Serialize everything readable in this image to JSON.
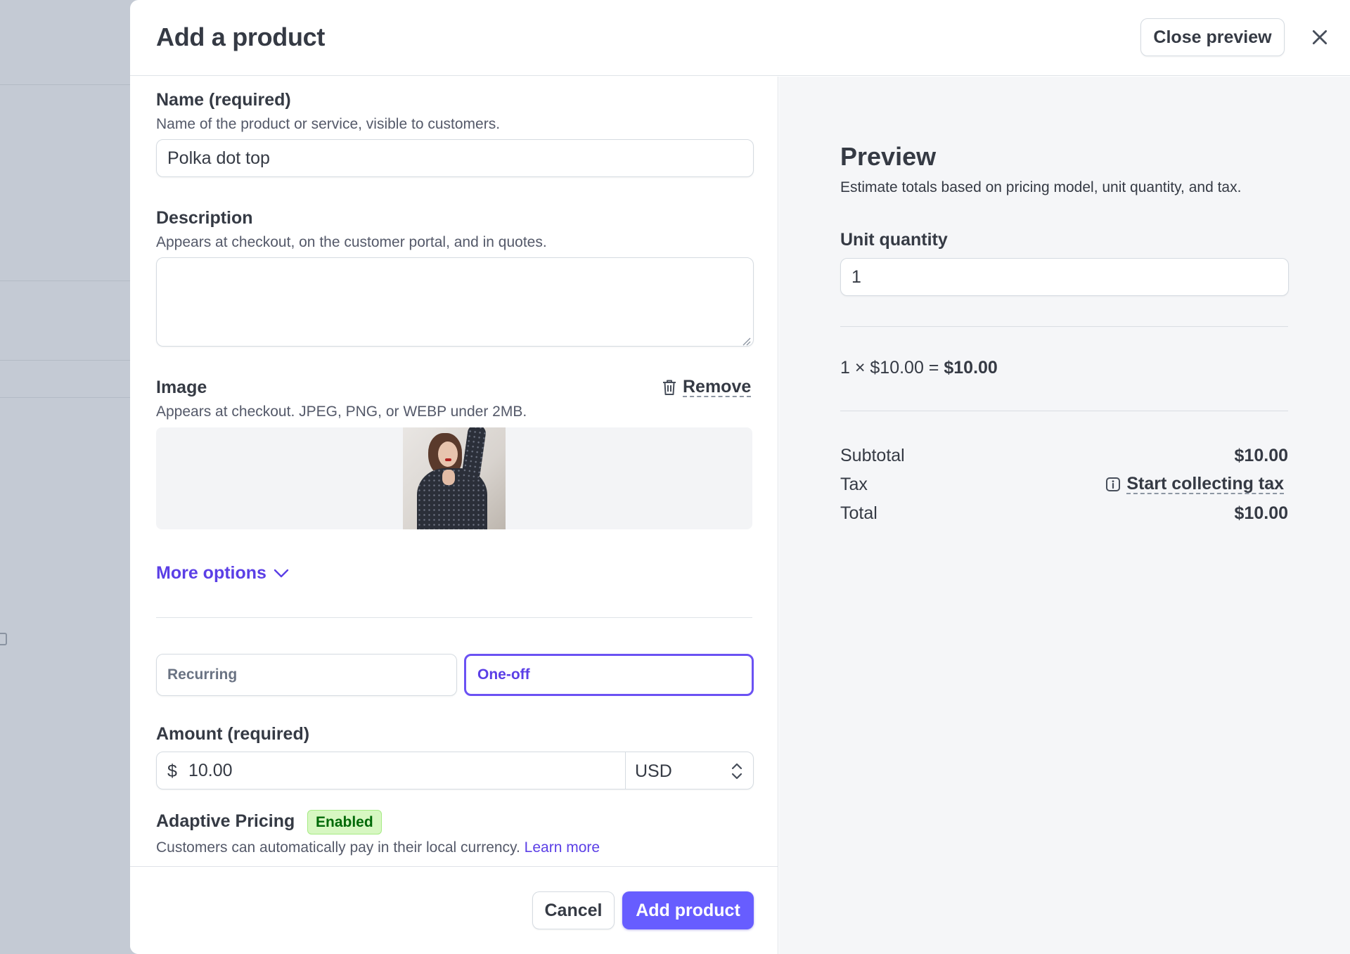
{
  "modal": {
    "title": "Add a product",
    "close_preview_label": "Close preview",
    "close_icon": "close-icon"
  },
  "form": {
    "name": {
      "label": "Name (required)",
      "hint": "Name of the product or service, visible to customers.",
      "value": "Polka dot top"
    },
    "description": {
      "label": "Description",
      "hint": "Appears at checkout, on the customer portal, and in quotes.",
      "value": ""
    },
    "image": {
      "label": "Image",
      "hint": "Appears at checkout. JPEG, PNG, or WEBP under 2MB.",
      "remove_label": "Remove",
      "remove_icon": "trash-icon"
    },
    "more_options_label": "More options",
    "pricing_type": {
      "options": [
        "Recurring",
        "One-off"
      ],
      "selected": "One-off"
    },
    "amount": {
      "label": "Amount (required)",
      "symbol": "$",
      "value": "10.00",
      "currency": "USD"
    },
    "adaptive_pricing": {
      "label": "Adaptive Pricing",
      "badge": "Enabled",
      "hint": "Customers can automatically pay in their local currency.",
      "link": "Learn more"
    }
  },
  "footer": {
    "cancel_label": "Cancel",
    "add_label": "Add product"
  },
  "preview": {
    "title": "Preview",
    "subtitle": "Estimate totals based on pricing model, unit quantity, and tax.",
    "unit_quantity_label": "Unit quantity",
    "unit_quantity_value": "1",
    "calc_prefix": "1 × $10.00 = ",
    "calc_total": "$10.00",
    "subtotal_label": "Subtotal",
    "subtotal_value": "$10.00",
    "tax_label": "Tax",
    "tax_link": "Start collecting tax",
    "total_label": "Total",
    "total_value": "$10.00"
  },
  "colors": {
    "accent": "#675dff",
    "accent_text": "#5b3fe6",
    "badge_bg": "#d7f7c2",
    "badge_text": "#006908"
  }
}
